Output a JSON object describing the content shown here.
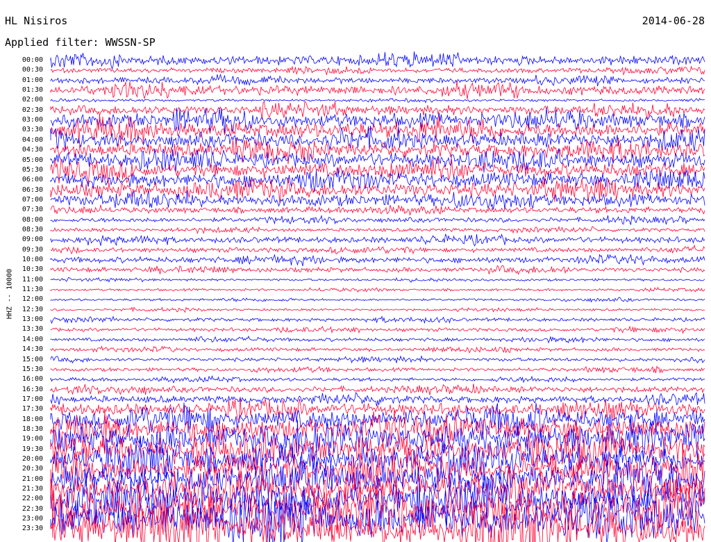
{
  "header": {
    "station": "HL Nisiros",
    "date": "2014-06-28",
    "filter": "Applied filter: WWSSN-SP"
  },
  "chart_data": {
    "type": "line",
    "title": "HL Nisiros",
    "ylabel": "HHZ -- 10000",
    "row_labels": [
      "00:00",
      "00:30",
      "01:00",
      "01:30",
      "02:00",
      "02:30",
      "03:00",
      "03:30",
      "04:00",
      "04:30",
      "05:00",
      "05:30",
      "06:00",
      "06:30",
      "07:00",
      "07:30",
      "08:00",
      "08:30",
      "09:00",
      "09:30",
      "10:00",
      "10:30",
      "11:00",
      "11:30",
      "12:00",
      "12:30",
      "13:00",
      "13:30",
      "14:00",
      "14:30",
      "15:00",
      "15:30",
      "16:00",
      "16:30",
      "17:00",
      "17:30",
      "18:00",
      "18:30",
      "19:00",
      "19:30",
      "20:00",
      "20:30",
      "21:00",
      "21:30",
      "22:00",
      "22:30",
      "23:00",
      "23:30"
    ],
    "colors": [
      "#0000ff",
      "#ff0033"
    ],
    "amplitude_per_row": [
      8,
      4,
      5,
      8,
      2,
      8,
      12,
      13,
      12,
      12,
      12,
      12,
      12,
      12,
      10,
      5,
      4,
      3,
      5,
      4,
      5,
      4,
      2,
      2,
      2,
      2,
      3,
      3,
      3,
      3,
      3,
      3,
      3,
      5,
      6,
      10,
      16,
      18,
      22,
      22,
      22,
      22,
      22,
      22,
      26,
      30,
      30,
      30
    ]
  }
}
